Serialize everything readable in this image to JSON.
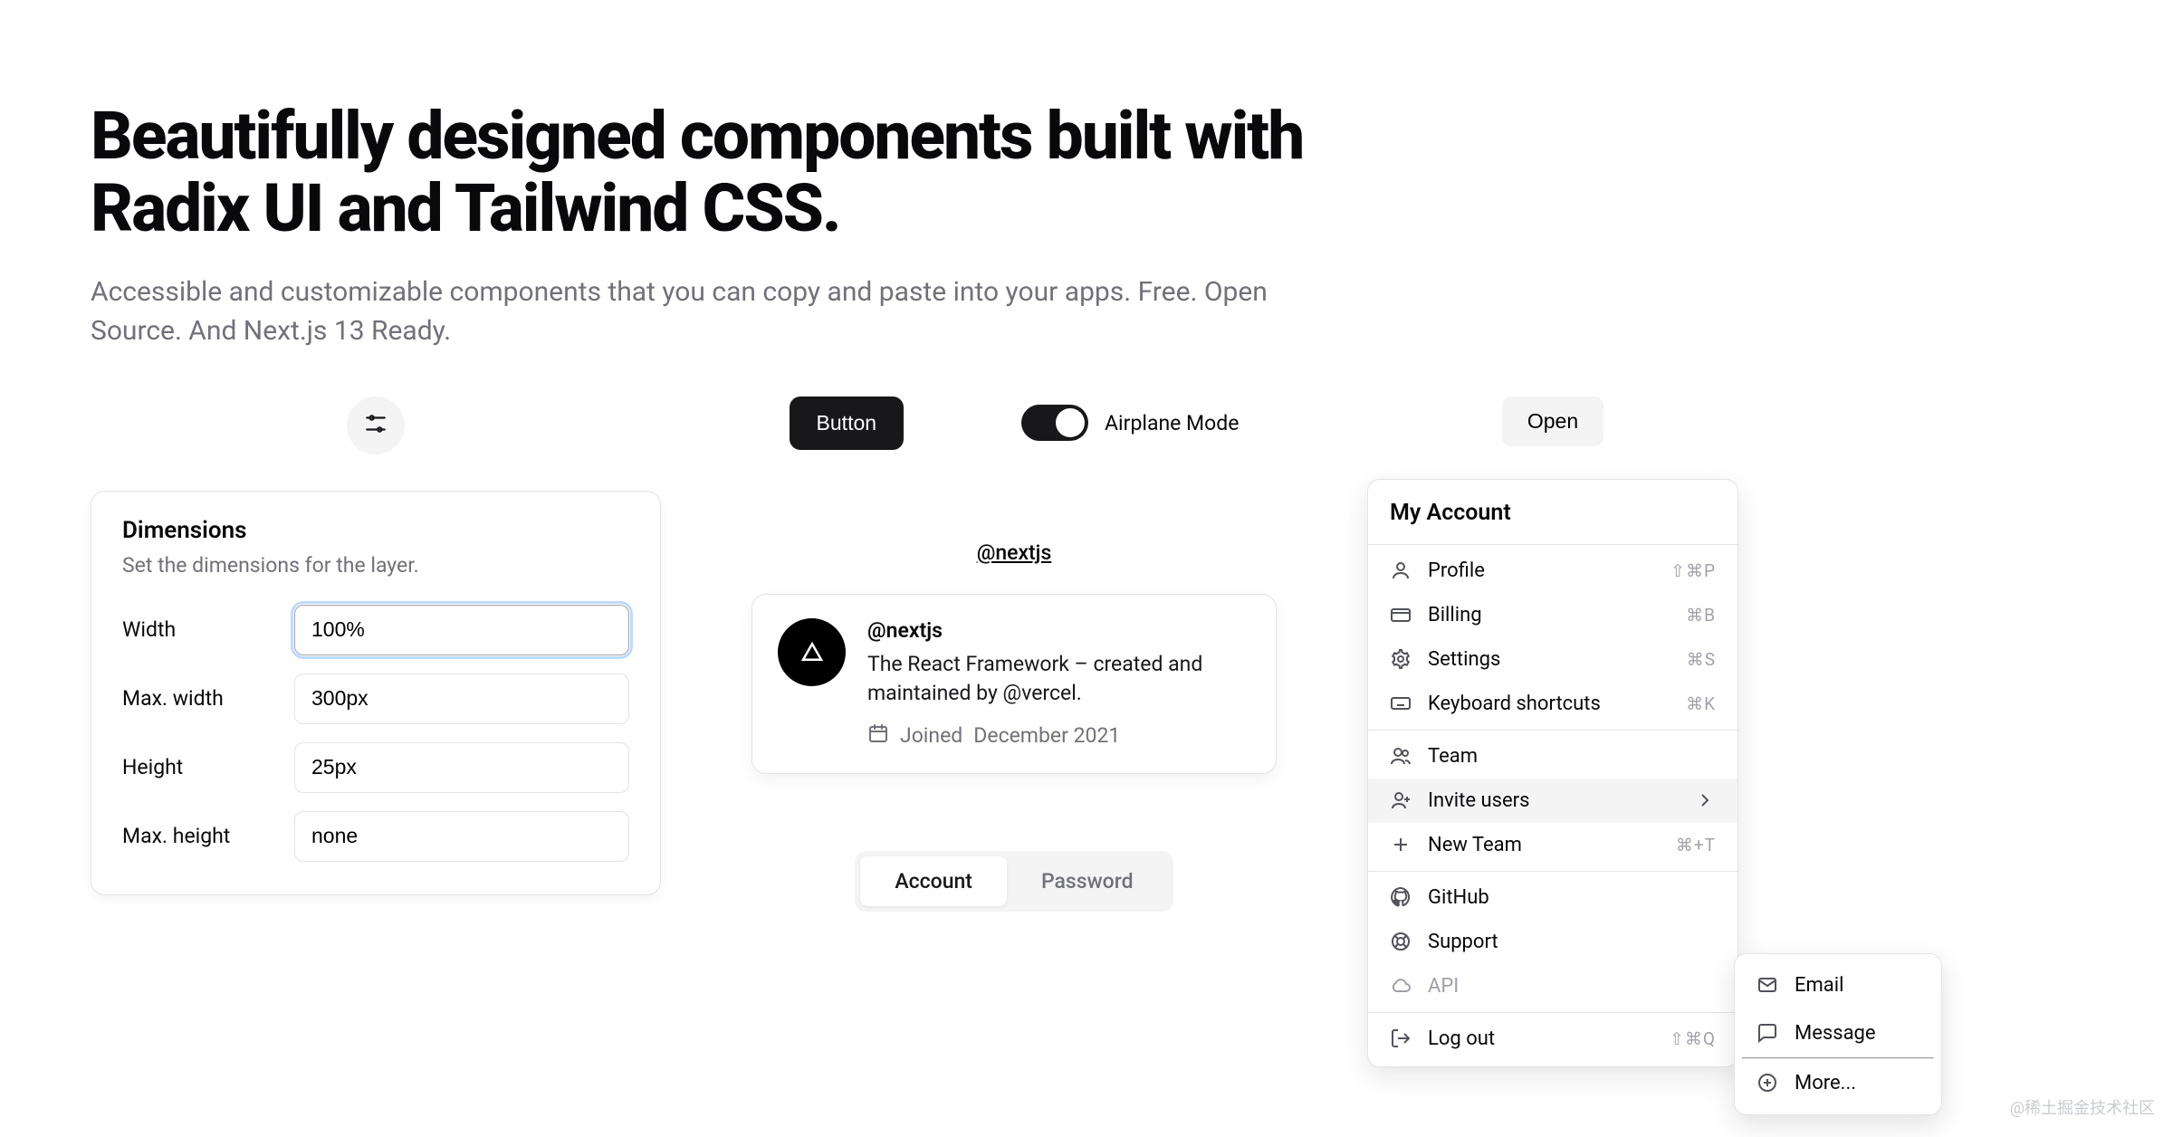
{
  "hero": {
    "title": "Beautifully designed components built with Radix UI and Tailwind CSS.",
    "subtitle": "Accessible and customizable components that you can copy and paste into your apps. Free. Open Source. And Next.js 13 Ready."
  },
  "dimensions": {
    "title": "Dimensions",
    "description": "Set the dimensions for the layer.",
    "fields": {
      "width": {
        "label": "Width",
        "value": "100%"
      },
      "maxWidth": {
        "label": "Max. width",
        "value": "300px"
      },
      "height": {
        "label": "Height",
        "value": "25px"
      },
      "maxHeight": {
        "label": "Max. height",
        "value": "none"
      }
    }
  },
  "button": {
    "label": "Button"
  },
  "switch": {
    "label": "Airplane Mode",
    "checked": true
  },
  "hovercard": {
    "triggerText": "@nextjs",
    "handle": "@nextjs",
    "bio": "The React Framework – created and maintained by @vercel.",
    "joinedPrefix": "Joined",
    "joined": "December 2021"
  },
  "tabs": {
    "account": "Account",
    "password": "Password"
  },
  "dropdown": {
    "open": "Open",
    "title": "My Account",
    "groups": {
      "account": {
        "profile": {
          "label": "Profile",
          "shortcut": "⇧⌘P"
        },
        "billing": {
          "label": "Billing",
          "shortcut": "⌘B"
        },
        "settings": {
          "label": "Settings",
          "shortcut": "⌘S"
        },
        "keyboard": {
          "label": "Keyboard shortcuts",
          "shortcut": "⌘K"
        }
      },
      "team": {
        "team": {
          "label": "Team"
        },
        "invite": {
          "label": "Invite users"
        },
        "newteam": {
          "label": "New Team",
          "shortcut": "⌘+T"
        }
      },
      "links": {
        "github": {
          "label": "GitHub"
        },
        "support": {
          "label": "Support"
        },
        "api": {
          "label": "API"
        }
      },
      "logout": {
        "label": "Log out",
        "shortcut": "⇧⌘Q"
      }
    },
    "submenu": {
      "email": "Email",
      "message": "Message",
      "more": "More..."
    }
  },
  "watermark": "@稀土掘金技术社区"
}
